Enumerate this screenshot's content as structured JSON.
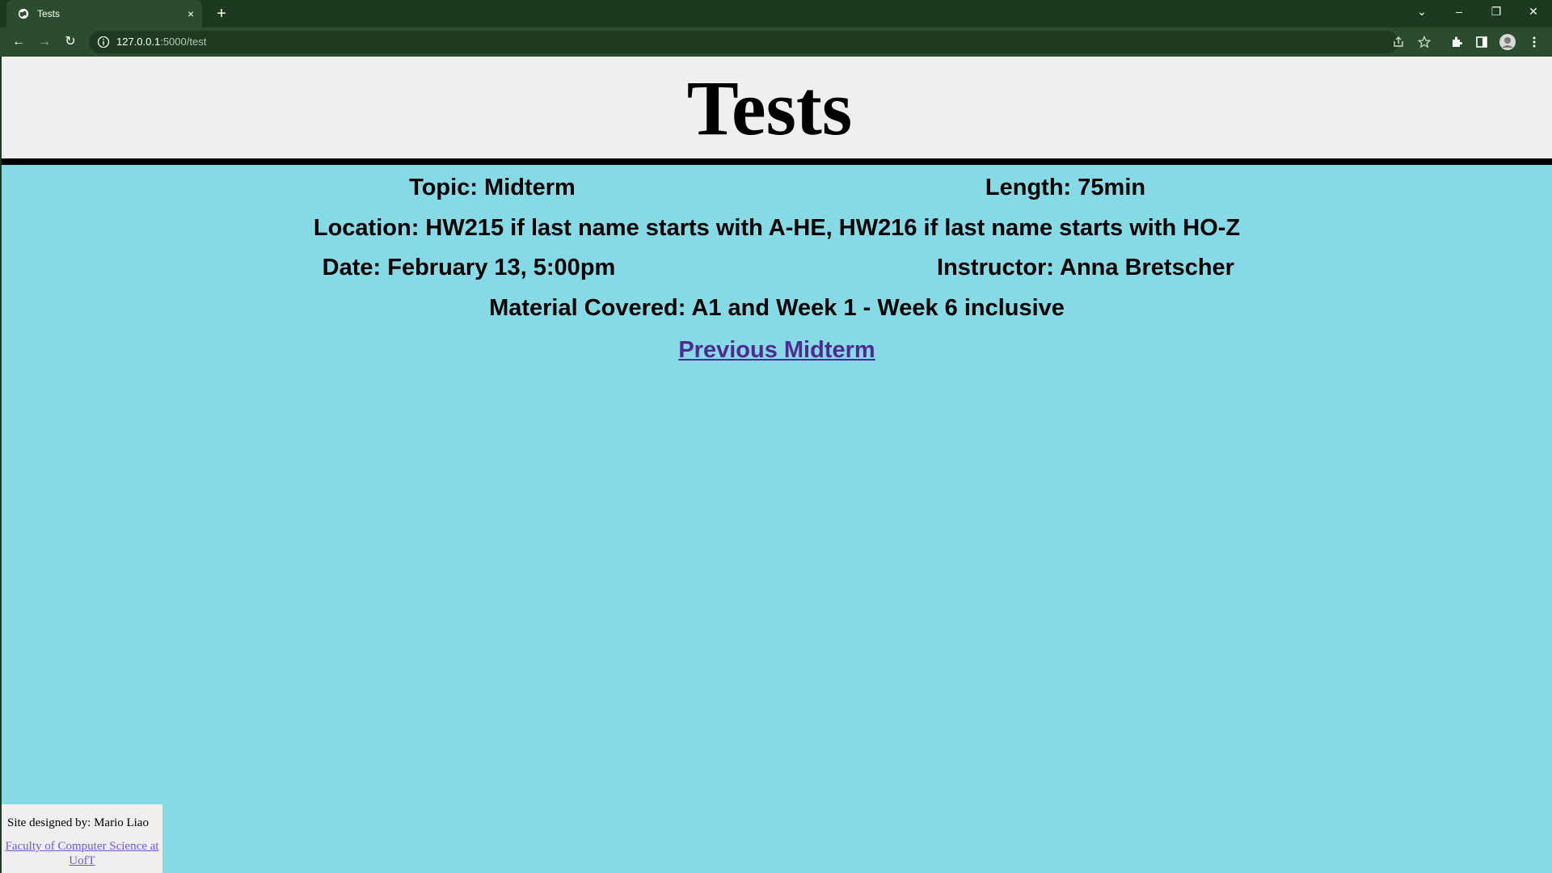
{
  "browser": {
    "tab_title": "Tests",
    "tab_close": "×",
    "new_tab": "+",
    "url_host": "127.0.0.1",
    "url_rest": ":5000/test",
    "window_controls": {
      "dropdown": "⌄",
      "minimize": "–",
      "restore": "❐",
      "close": "✕"
    },
    "nav": {
      "back": "←",
      "forward": "→",
      "reload": "↻"
    },
    "colors": {
      "frame": "#1b3a1f",
      "toolbar": "#2b4c2f"
    }
  },
  "header": {
    "title": "Tests"
  },
  "test_info": {
    "topic": "Topic: Midterm",
    "length": "Length: 75min",
    "location": "Location: HW215 if last name starts with A-HE, HW216 if last name starts with HO-Z",
    "date": "Date: February 13, 5:00pm",
    "instructor": "Instructor: Anna Bretscher",
    "material": "Material Covered: A1 and Week 1 - Week 6 inclusive",
    "previous_link": "Previous Midterm"
  },
  "footer": {
    "designer": "Site designed by: Mario Liao",
    "faculty_link": "Faculty of Computer Science at UofT"
  },
  "colors": {
    "page_bg": "#86dae6",
    "header_bg": "#f0eff0",
    "link": "#4f2b90"
  }
}
